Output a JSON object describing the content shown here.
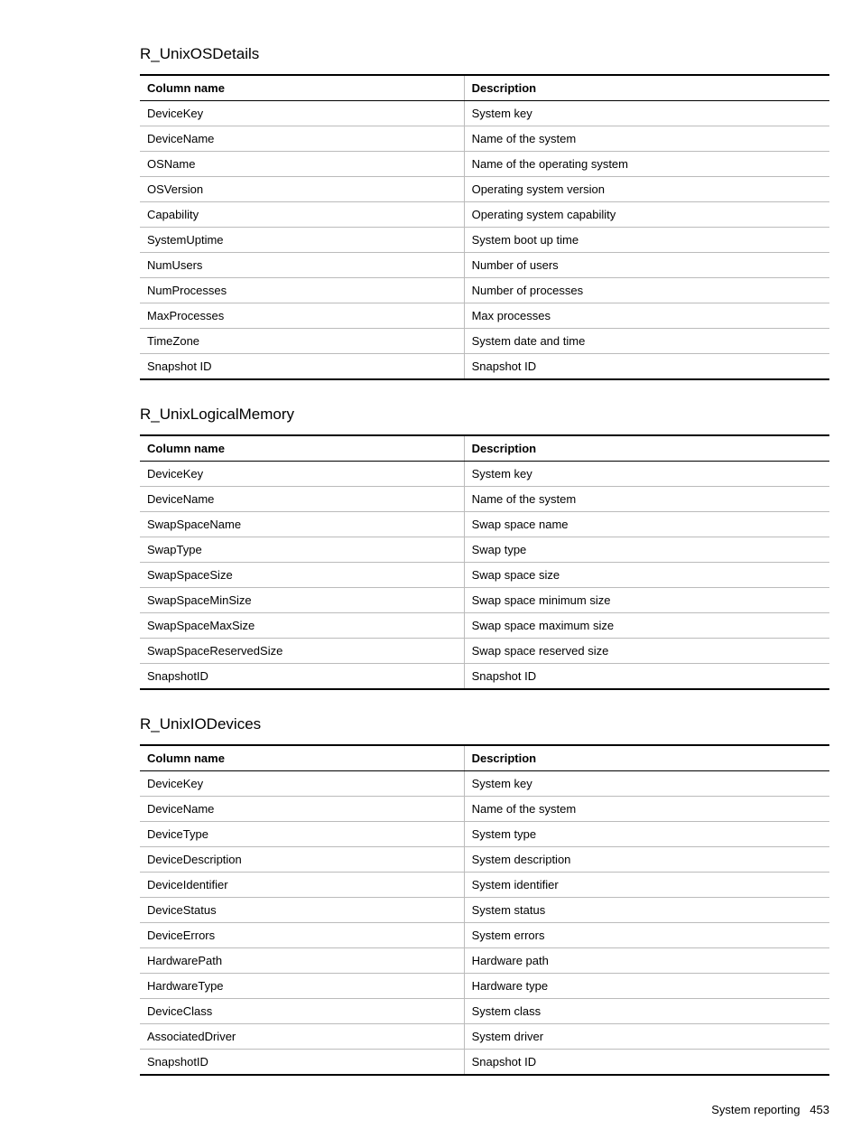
{
  "sections": [
    {
      "title": "R_UnixOSDetails",
      "headers": {
        "col1": "Column name",
        "col2": "Description"
      },
      "rows": [
        {
          "col1": "DeviceKey",
          "col2": "System key"
        },
        {
          "col1": "DeviceName",
          "col2": "Name of the system"
        },
        {
          "col1": "OSName",
          "col2": "Name of the operating system"
        },
        {
          "col1": "OSVersion",
          "col2": "Operating system version"
        },
        {
          "col1": "Capability",
          "col2": "Operating system capability"
        },
        {
          "col1": "SystemUptime",
          "col2": "System boot up time"
        },
        {
          "col1": "NumUsers",
          "col2": "Number of users"
        },
        {
          "col1": "NumProcesses",
          "col2": "Number of processes"
        },
        {
          "col1": "MaxProcesses",
          "col2": "Max processes"
        },
        {
          "col1": "TimeZone",
          "col2": "System date and time"
        },
        {
          "col1": "Snapshot ID",
          "col2": "Snapshot ID"
        }
      ]
    },
    {
      "title": "R_UnixLogicalMemory",
      "headers": {
        "col1": "Column name",
        "col2": "Description"
      },
      "rows": [
        {
          "col1": "DeviceKey",
          "col2": "System key"
        },
        {
          "col1": "DeviceName",
          "col2": "Name of the system"
        },
        {
          "col1": "SwapSpaceName",
          "col2": "Swap space name"
        },
        {
          "col1": "SwapType",
          "col2": "Swap type"
        },
        {
          "col1": "SwapSpaceSize",
          "col2": "Swap space size"
        },
        {
          "col1": "SwapSpaceMinSize",
          "col2": "Swap space minimum size"
        },
        {
          "col1": "SwapSpaceMaxSize",
          "col2": "Swap space maximum size"
        },
        {
          "col1": "SwapSpaceReservedSize",
          "col2": "Swap space reserved size"
        },
        {
          "col1": "SnapshotID",
          "col2": "Snapshot ID"
        }
      ]
    },
    {
      "title": "R_UnixIODevices",
      "headers": {
        "col1": "Column name",
        "col2": "Description"
      },
      "rows": [
        {
          "col1": "DeviceKey",
          "col2": "System key"
        },
        {
          "col1": "DeviceName",
          "col2": "Name of the system"
        },
        {
          "col1": "DeviceType",
          "col2": "System type"
        },
        {
          "col1": "DeviceDescription",
          "col2": "System description"
        },
        {
          "col1": "DeviceIdentifier",
          "col2": "System identifier"
        },
        {
          "col1": "DeviceStatus",
          "col2": "System status"
        },
        {
          "col1": "DeviceErrors",
          "col2": "System errors"
        },
        {
          "col1": "HardwarePath",
          "col2": "Hardware path"
        },
        {
          "col1": "HardwareType",
          "col2": "Hardware type"
        },
        {
          "col1": "DeviceClass",
          "col2": "System class"
        },
        {
          "col1": "AssociatedDriver",
          "col2": "System driver"
        },
        {
          "col1": "SnapshotID",
          "col2": "Snapshot ID"
        }
      ]
    }
  ],
  "footer": {
    "label": "System reporting",
    "page": "453"
  }
}
